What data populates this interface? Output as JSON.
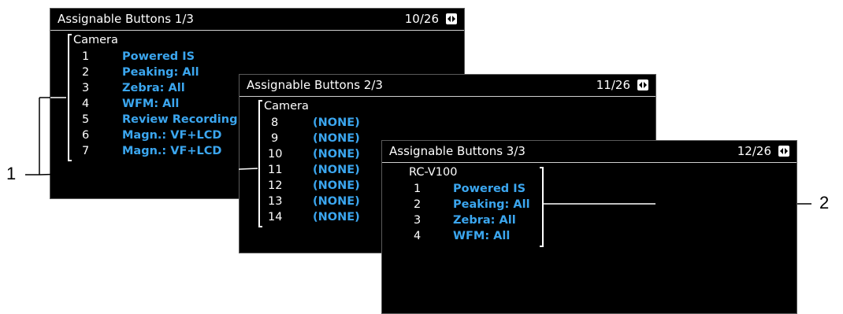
{
  "screens": [
    {
      "title": "Assignable Buttons 1/3",
      "page": "10/26",
      "group": "Camera",
      "items": [
        {
          "num": "1",
          "value": "Powered IS"
        },
        {
          "num": "2",
          "value": "Peaking: All"
        },
        {
          "num": "3",
          "value": "Zebra: All"
        },
        {
          "num": "4",
          "value": "WFM: All"
        },
        {
          "num": "5",
          "value": "Review Recording"
        },
        {
          "num": "6",
          "value": "Magn.: VF+LCD"
        },
        {
          "num": "7",
          "value": "Magn.: VF+LCD"
        }
      ]
    },
    {
      "title": "Assignable Buttons 2/3",
      "page": "11/26",
      "group": "Camera",
      "items": [
        {
          "num": "8",
          "value": "(NONE)"
        },
        {
          "num": "9",
          "value": "(NONE)"
        },
        {
          "num": "10",
          "value": "(NONE)"
        },
        {
          "num": "11",
          "value": "(NONE)"
        },
        {
          "num": "12",
          "value": "(NONE)"
        },
        {
          "num": "13",
          "value": "(NONE)"
        },
        {
          "num": "14",
          "value": "(NONE)"
        }
      ]
    },
    {
      "title": "Assignable Buttons 3/3",
      "page": "12/26",
      "group": "RC-V100",
      "items": [
        {
          "num": "1",
          "value": "Powered IS"
        },
        {
          "num": "2",
          "value": "Peaking: All"
        },
        {
          "num": "3",
          "value": "Zebra: All"
        },
        {
          "num": "4",
          "value": "WFM: All"
        }
      ]
    }
  ],
  "callouts": {
    "left": "1",
    "right": "2"
  },
  "icons": {
    "page_arrows": "left-right-arrows-icon"
  },
  "colors": {
    "value_text": "#3ba6ef",
    "screen_bg": "#000000"
  }
}
